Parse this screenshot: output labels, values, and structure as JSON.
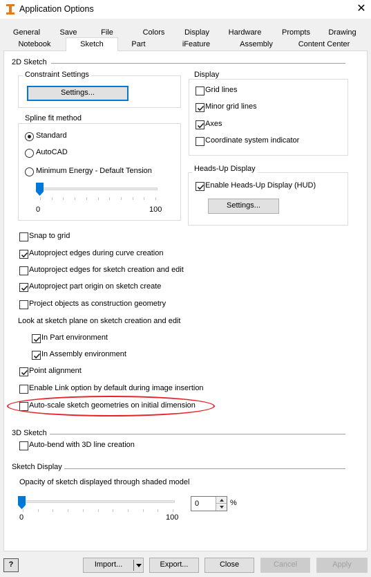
{
  "window": {
    "title": "Application Options",
    "icon": "inventor-app-icon",
    "close_glyph": "✕"
  },
  "tabs_row1": [
    "General",
    "Save",
    "File",
    "Colors",
    "Display",
    "Hardware",
    "Prompts",
    "Drawing"
  ],
  "tabs_row2": [
    "Notebook",
    "Sketch",
    "Part",
    "iFeature",
    "Assembly",
    "Content Center"
  ],
  "active_tab": "Sketch",
  "sketch2d": {
    "section_label": "2D Sketch",
    "constraint": {
      "label": "Constraint Settings",
      "button": "Settings..."
    },
    "spline": {
      "label": "Spline fit method",
      "options": [
        "Standard",
        "AutoCAD",
        "Minimum Energy - Default Tension"
      ],
      "selected": "Standard",
      "slider_min": "0",
      "slider_max": "100",
      "slider_value": 0
    },
    "display": {
      "label": "Display",
      "items": [
        {
          "label": "Grid lines",
          "checked": false
        },
        {
          "label": "Minor grid lines",
          "checked": true
        },
        {
          "label": "Axes",
          "checked": true
        },
        {
          "label": "Coordinate system indicator",
          "checked": false
        }
      ]
    },
    "hud": {
      "label": "Heads-Up Display",
      "enable": {
        "label": "Enable Heads-Up Display (HUD)",
        "checked": true
      },
      "button": "Settings..."
    },
    "options": [
      {
        "label": "Snap to grid",
        "checked": false
      },
      {
        "label": "Autoproject edges during curve creation",
        "checked": true
      },
      {
        "label": "Autoproject edges for sketch creation and edit",
        "checked": false
      },
      {
        "label": "Autoproject part origin on sketch create",
        "checked": true
      },
      {
        "label": "Project objects as construction geometry",
        "checked": false
      }
    ],
    "look_at_label": "Look at sketch plane on sketch creation and edit",
    "look_at": [
      {
        "label": "In Part environment",
        "checked": true
      },
      {
        "label": "In Assembly environment",
        "checked": true
      }
    ],
    "more_options": [
      {
        "label": "Point alignment",
        "checked": true
      },
      {
        "label": "Enable Link option by default during image insertion",
        "checked": false
      },
      {
        "label": "Auto-scale sketch geometries on initial dimension",
        "checked": false
      }
    ]
  },
  "sketch3d": {
    "section_label": "3D Sketch",
    "autobend": {
      "label": "Auto-bend with 3D line creation",
      "checked": false
    }
  },
  "sketch_display": {
    "section_label": "Sketch Display",
    "opacity_label": "Opacity of sketch displayed through shaded model",
    "slider_min": "0",
    "slider_max": "100",
    "slider_value": 0,
    "spin_value": "0",
    "unit": "%"
  },
  "footer": {
    "help": "?",
    "import": "Import...",
    "export": "Export...",
    "close": "Close",
    "cancel": "Cancel",
    "apply": "Apply"
  },
  "colors": {
    "accent": "#0078d7",
    "highlight_ring": "#e8222a"
  }
}
